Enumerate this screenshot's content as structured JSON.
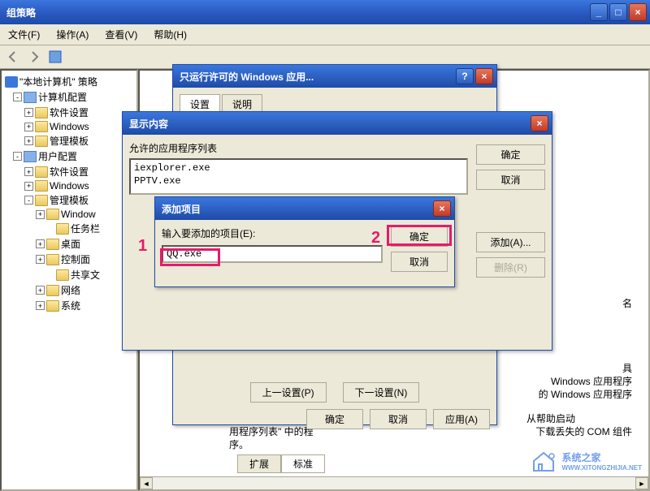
{
  "main_window": {
    "title": "组策略",
    "menubar": [
      "文件(F)",
      "操作(A)",
      "查看(V)",
      "帮助(H)"
    ],
    "minimize": "_",
    "maximize": "□",
    "close": "×"
  },
  "tree": {
    "root": "\"本地计算机\" 策略",
    "nodes": [
      {
        "label": "计算机配置",
        "icon": "config",
        "toggle": "-",
        "indent": 10
      },
      {
        "label": "软件设置",
        "icon": "folder",
        "toggle": "+",
        "indent": 24
      },
      {
        "label": "Windows",
        "icon": "folder",
        "toggle": "+",
        "indent": 24
      },
      {
        "label": "管理模板",
        "icon": "folder",
        "toggle": "+",
        "indent": 24
      },
      {
        "label": "用户配置",
        "icon": "config",
        "toggle": "-",
        "indent": 10
      },
      {
        "label": "软件设置",
        "icon": "folder",
        "toggle": "+",
        "indent": 24
      },
      {
        "label": "Windows",
        "icon": "folder",
        "toggle": "+",
        "indent": 24
      },
      {
        "label": "管理模板",
        "icon": "folder",
        "toggle": "-",
        "indent": 24
      },
      {
        "label": "Window",
        "icon": "folder",
        "toggle": "+",
        "indent": 38
      },
      {
        "label": "任务栏",
        "icon": "folder",
        "toggle": "",
        "indent": 50
      },
      {
        "label": "桌面",
        "icon": "folder",
        "toggle": "+",
        "indent": 38
      },
      {
        "label": "控制面",
        "icon": "folder",
        "toggle": "+",
        "indent": 38
      },
      {
        "label": "共享文",
        "icon": "folder",
        "toggle": "",
        "indent": 50
      },
      {
        "label": "网络",
        "icon": "folder",
        "toggle": "+",
        "indent": 38
      },
      {
        "label": "系统",
        "icon": "folder",
        "toggle": "+",
        "indent": 38
      }
    ]
  },
  "policy_window": {
    "title": "只运行许可的 Windows 应用...",
    "tabs": [
      "设置",
      "说明"
    ],
    "prev_setting": "上一设置(P)",
    "next_setting": "下一设置(N)",
    "ok": "确定",
    "cancel": "取消",
    "apply": "应用(A)"
  },
  "show_contents": {
    "title": "显示内容",
    "list_label": "允许的应用程序列表",
    "items": [
      "iexplorer.exe",
      "PPTV.exe"
    ],
    "ok": "确定",
    "cancel": "取消",
    "add": "添加(A)...",
    "remove": "删除(R)"
  },
  "add_item": {
    "title": "添加项目",
    "prompt": "输入要添加的项目(E):",
    "value": "QQ.exe",
    "ok": "确定",
    "cancel": "取消"
  },
  "annotations": {
    "marker1": "1",
    "marker2": "2"
  },
  "background_text": {
    "line1": "名",
    "line2": "具",
    "line3": "Windows 应用程序",
    "line4": "的 Windows 应用程序",
    "line5": "从帮助启动",
    "line6": "下载丢失的 COM 组件",
    "line7": "用程序列表\" 中的程",
    "line8": "序。"
  },
  "status_tabs": [
    "扩展",
    "标准"
  ],
  "watermark": "系统之家",
  "watermark_sub": "WWW.XITONGZHIJIA.NET"
}
